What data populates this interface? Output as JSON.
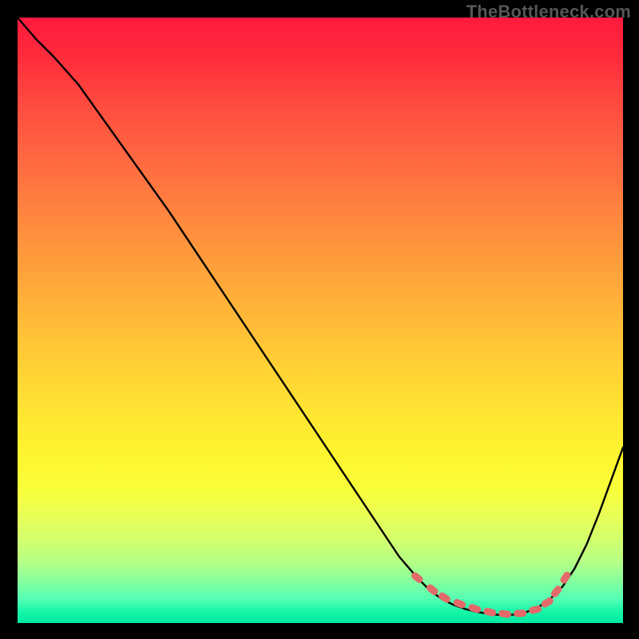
{
  "watermark": "TheBottleneck.com",
  "colors": {
    "page_bg": "#000000",
    "curve": "#000000",
    "marker": "#e46a6a",
    "gradient_top": "#ff1a3c",
    "gradient_mid": "#ffe233",
    "gradient_bottom": "#00eaa2"
  },
  "chart_data": {
    "type": "line",
    "title": "",
    "xlabel": "",
    "ylabel": "",
    "xlim": [
      0,
      100
    ],
    "ylim": [
      0,
      100
    ],
    "grid": false,
    "legend": false,
    "series": [
      {
        "name": "bottleneck-curve",
        "x": [
          0,
          3,
          6,
          10,
          15,
          20,
          25,
          30,
          35,
          40,
          45,
          50,
          55,
          60,
          63,
          66,
          68,
          70,
          72,
          74,
          76,
          78,
          80,
          82,
          84,
          86,
          88,
          90,
          92,
          94,
          96,
          100
        ],
        "y": [
          100,
          96.5,
          93.5,
          89,
          82,
          75,
          68,
          60.5,
          53,
          45.5,
          38,
          30.5,
          23,
          15.5,
          11,
          7.5,
          5.5,
          4,
          3,
          2.3,
          1.8,
          1.5,
          1.3,
          1.4,
          1.8,
          2.6,
          4,
          6,
          9,
          13,
          18,
          29
        ]
      }
    ],
    "markers": {
      "name": "highlight-dots",
      "x": [
        66,
        68.5,
        70.5,
        73,
        75.5,
        78,
        80.5,
        83,
        85.5,
        87.5,
        89,
        90.5
      ],
      "y": [
        7.5,
        5.5,
        4.2,
        3.2,
        2.4,
        1.8,
        1.5,
        1.6,
        2.2,
        3.4,
        5.2,
        7.5
      ]
    }
  }
}
